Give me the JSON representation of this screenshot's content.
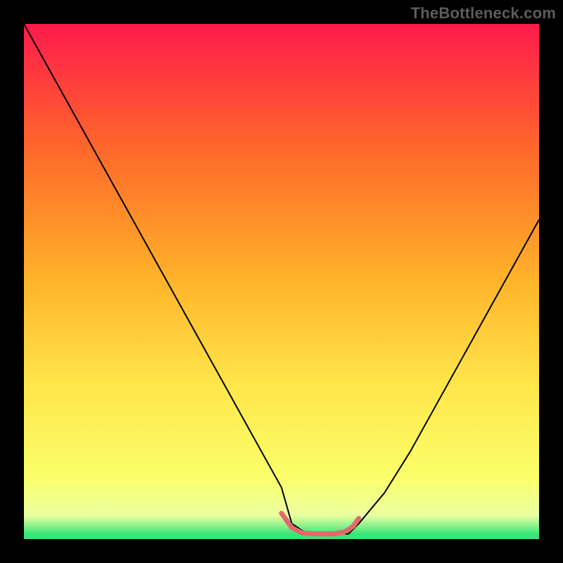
{
  "watermark": {
    "text": "TheBottleneck.com"
  },
  "chart_data": {
    "type": "line",
    "title": "",
    "xlabel": "",
    "ylabel": "",
    "xlim": [
      0,
      100
    ],
    "ylim": [
      0,
      100
    ],
    "grid": false,
    "legend": false,
    "gradient": {
      "stops": [
        {
          "offset": 0.0,
          "color": "#ff1a4b"
        },
        {
          "offset": 0.25,
          "color": "#ff6a2a"
        },
        {
          "offset": 0.5,
          "color": "#ffb42a"
        },
        {
          "offset": 0.7,
          "color": "#ffe64a"
        },
        {
          "offset": 0.88,
          "color": "#fbff6a"
        },
        {
          "offset": 0.955,
          "color": "#eaffa0"
        },
        {
          "offset": 0.99,
          "color": "#39e67a"
        }
      ]
    },
    "series": [
      {
        "name": "curve",
        "color": "#000000",
        "width": 2,
        "x": [
          0,
          5,
          10,
          15,
          20,
          25,
          30,
          35,
          40,
          45,
          50,
          52,
          55,
          60,
          63,
          65,
          70,
          75,
          80,
          85,
          90,
          95,
          100
        ],
        "y": [
          100,
          91,
          82,
          73,
          64,
          55,
          46,
          37,
          28,
          19,
          10,
          3,
          1,
          1,
          1,
          3,
          9,
          17,
          26,
          35,
          44,
          53,
          62
        ]
      },
      {
        "name": "highlight",
        "color": "#e06a6a",
        "width": 7,
        "linecap": "round",
        "x": [
          50,
          52,
          54,
          56,
          58,
          60,
          62,
          63,
          64,
          65
        ],
        "y": [
          5,
          2.2,
          1.2,
          1.0,
          1.0,
          1.0,
          1.3,
          1.8,
          2.6,
          4
        ]
      }
    ]
  }
}
